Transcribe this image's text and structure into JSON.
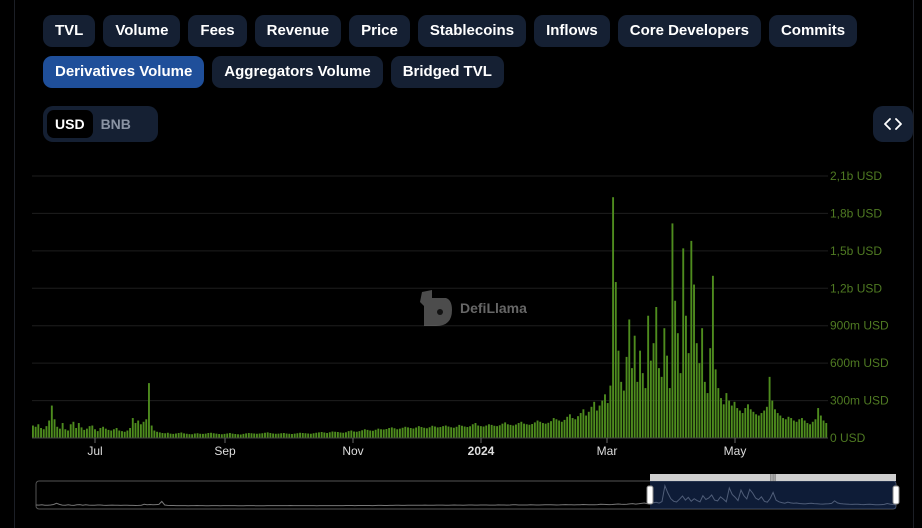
{
  "tabs_row1": [
    "TVL",
    "Volume",
    "Fees",
    "Revenue",
    "Price",
    "Stablecoins",
    "Inflows",
    "Core Developers",
    "Commits"
  ],
  "tabs_row2": [
    "Derivatives Volume",
    "Aggregators Volume",
    "Bridged TVL"
  ],
  "active_tab": "Derivatives Volume",
  "currency": {
    "options": [
      "USD",
      "BNB"
    ],
    "selected": "USD"
  },
  "embed_icon": "code-brackets-icon",
  "watermark": "DefiLlama",
  "colors": {
    "bar": "#4e8c1e",
    "axis_label": "#4f7a22",
    "accent": "#1f4f9a",
    "brush": "#1e3e7a"
  },
  "chart_data": {
    "type": "bar",
    "title": "",
    "xlabel": "",
    "ylabel": "",
    "ylim": [
      0,
      2100000000
    ],
    "y_ticks": [
      "0 USD",
      "300m USD",
      "600m USD",
      "900m USD",
      "1,2b USD",
      "1,5b USD",
      "1,8b USD",
      "2,1b USD"
    ],
    "x_ticks": [
      "Jul",
      "Sep",
      "Nov",
      "2024",
      "Mar",
      "May"
    ],
    "x_range": [
      "2023-06-01",
      "2024-06-08"
    ],
    "series": [
      {
        "values": [
          100000000,
          90000000,
          110000000,
          80000000,
          70000000,
          95000000,
          140000000,
          260000000,
          150000000,
          90000000,
          75000000,
          120000000,
          70000000,
          60000000,
          110000000,
          130000000,
          80000000,
          120000000,
          85000000,
          65000000,
          75000000,
          95000000,
          100000000,
          70000000,
          55000000,
          80000000,
          90000000,
          75000000,
          65000000,
          60000000,
          70000000,
          80000000,
          60000000,
          55000000,
          50000000,
          60000000,
          80000000,
          160000000,
          120000000,
          140000000,
          110000000,
          130000000,
          150000000,
          440000000,
          100000000,
          60000000,
          50000000,
          45000000,
          40000000,
          38000000,
          42000000,
          35000000,
          33000000,
          36000000,
          40000000,
          44000000,
          37000000,
          34000000,
          31000000,
          30000000,
          36000000,
          38000000,
          34000000,
          33000000,
          35000000,
          40000000,
          42000000,
          38000000,
          35000000,
          32000000,
          30000000,
          33000000,
          36000000,
          40000000,
          35000000,
          32000000,
          30000000,
          28000000,
          33000000,
          37000000,
          40000000,
          38000000,
          36000000,
          34000000,
          36000000,
          38000000,
          42000000,
          45000000,
          40000000,
          36000000,
          34000000,
          35000000,
          38000000,
          40000000,
          36000000,
          34000000,
          32000000,
          35000000,
          38000000,
          42000000,
          40000000,
          38000000,
          36000000,
          34000000,
          38000000,
          42000000,
          45000000,
          48000000,
          44000000,
          40000000,
          46000000,
          52000000,
          50000000,
          48000000,
          44000000,
          42000000,
          46000000,
          55000000,
          60000000,
          52000000,
          50000000,
          55000000,
          62000000,
          70000000,
          65000000,
          60000000,
          58000000,
          66000000,
          75000000,
          70000000,
          68000000,
          72000000,
          80000000,
          85000000,
          78000000,
          70000000,
          75000000,
          82000000,
          90000000,
          85000000,
          80000000,
          76000000,
          84000000,
          95000000,
          88000000,
          82000000,
          78000000,
          86000000,
          98000000,
          92000000,
          85000000,
          88000000,
          95000000,
          100000000,
          92000000,
          86000000,
          82000000,
          90000000,
          105000000,
          98000000,
          92000000,
          88000000,
          94000000,
          110000000,
          120000000,
          100000000,
          95000000,
          92000000,
          100000000,
          110000000,
          105000000,
          98000000,
          95000000,
          102000000,
          115000000,
          125000000,
          110000000,
          105000000,
          100000000,
          108000000,
          120000000,
          130000000,
          115000000,
          110000000,
          106000000,
          112000000,
          125000000,
          140000000,
          130000000,
          120000000,
          115000000,
          122000000,
          135000000,
          160000000,
          150000000,
          140000000,
          130000000,
          145000000,
          170000000,
          190000000,
          160000000,
          150000000,
          175000000,
          200000000,
          230000000,
          180000000,
          210000000,
          250000000,
          290000000,
          220000000,
          260000000,
          300000000,
          350000000,
          280000000,
          420000000,
          1930000000,
          1250000000,
          700000000,
          450000000,
          380000000,
          650000000,
          950000000,
          560000000,
          820000000,
          450000000,
          700000000,
          520000000,
          400000000,
          980000000,
          620000000,
          760000000,
          1050000000,
          560000000,
          490000000,
          880000000,
          660000000,
          400000000,
          1720000000,
          1100000000,
          840000000,
          520000000,
          1520000000,
          980000000,
          680000000,
          1580000000,
          1230000000,
          760000000,
          600000000,
          880000000,
          450000000,
          360000000,
          720000000,
          1300000000,
          550000000,
          400000000,
          320000000,
          270000000,
          360000000,
          300000000,
          260000000,
          290000000,
          240000000,
          220000000,
          200000000,
          240000000,
          270000000,
          230000000,
          210000000,
          190000000,
          180000000,
          200000000,
          220000000,
          250000000,
          490000000,
          300000000,
          230000000,
          200000000,
          180000000,
          160000000,
          150000000,
          170000000,
          160000000,
          140000000,
          130000000,
          150000000,
          160000000,
          140000000,
          120000000,
          110000000,
          130000000,
          150000000,
          240000000,
          180000000,
          140000000,
          120000000
        ]
      }
    ]
  }
}
